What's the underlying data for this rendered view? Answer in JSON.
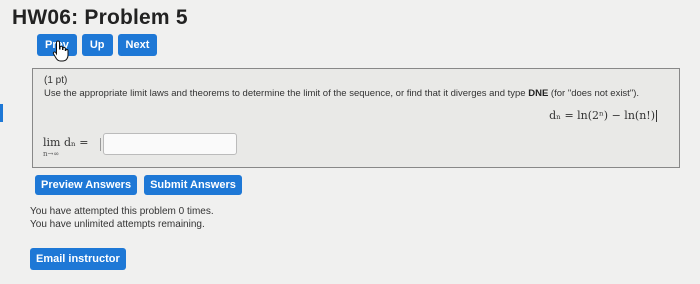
{
  "page": {
    "title": "HW06: Problem 5"
  },
  "nav": {
    "prev": "Prev",
    "up": "Up",
    "next": "Next"
  },
  "problem": {
    "points": "(1 pt)",
    "instruction_pre": "Use the appropriate limit laws and theorems to determine the limit of the sequence, or find that it diverges and type ",
    "instruction_bold": "DNE",
    "instruction_post": " (for \"does not exist\").",
    "formula": "dₙ = ln(2ⁿ) − ln(n!)",
    "limit_label": "lim  dₙ =",
    "limit_sub": "n→∞",
    "answer_value": ""
  },
  "actions": {
    "preview": "Preview Answers",
    "submit": "Submit Answers"
  },
  "status": {
    "attempts": "You have attempted this problem 0 times.",
    "remaining": "You have unlimited attempts remaining."
  },
  "footer": {
    "email": "Email instructor"
  },
  "colors": {
    "button": "#1e78d6",
    "background": "#f0f0ef"
  }
}
